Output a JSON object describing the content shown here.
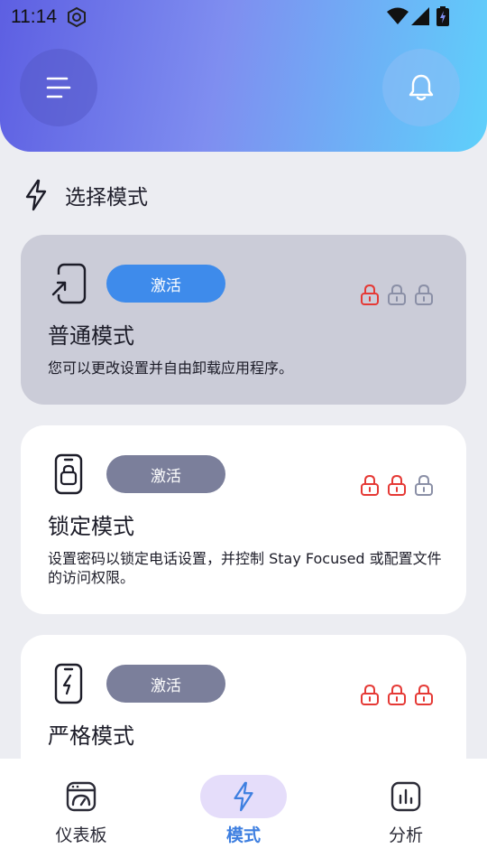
{
  "status_bar": {
    "time": "11:14"
  },
  "header": {
    "menu_icon": "menu-icon",
    "bell_icon": "bell-icon"
  },
  "section": {
    "title": "选择模式",
    "icon": "bolt-icon"
  },
  "colors": {
    "active_button": "#3E8BEB",
    "inactive_button": "#7B7F9B",
    "lock_red": "#E53935",
    "lock_gray": "#8A8FA6"
  },
  "modes": [
    {
      "title": "普通模式",
      "description": "您可以更改设置并自由卸载应用程序。",
      "button": "激活",
      "active": true,
      "locks": [
        "red",
        "gray",
        "gray"
      ]
    },
    {
      "title": "锁定模式",
      "description": "设置密码以锁定电话设置，并控制 Stay Focused 或配置文件的访问权限。",
      "button": "激活",
      "active": false,
      "locks": [
        "red",
        "red",
        "gray"
      ]
    },
    {
      "title": "严格模式",
      "description": "",
      "button": "激活",
      "active": false,
      "locks": [
        "red",
        "red",
        "red"
      ]
    }
  ],
  "nav": [
    {
      "label": "仪表板",
      "icon": "dashboard-icon"
    },
    {
      "label": "模式",
      "icon": "bolt-icon",
      "active": true
    },
    {
      "label": "分析",
      "icon": "analytics-icon"
    }
  ]
}
